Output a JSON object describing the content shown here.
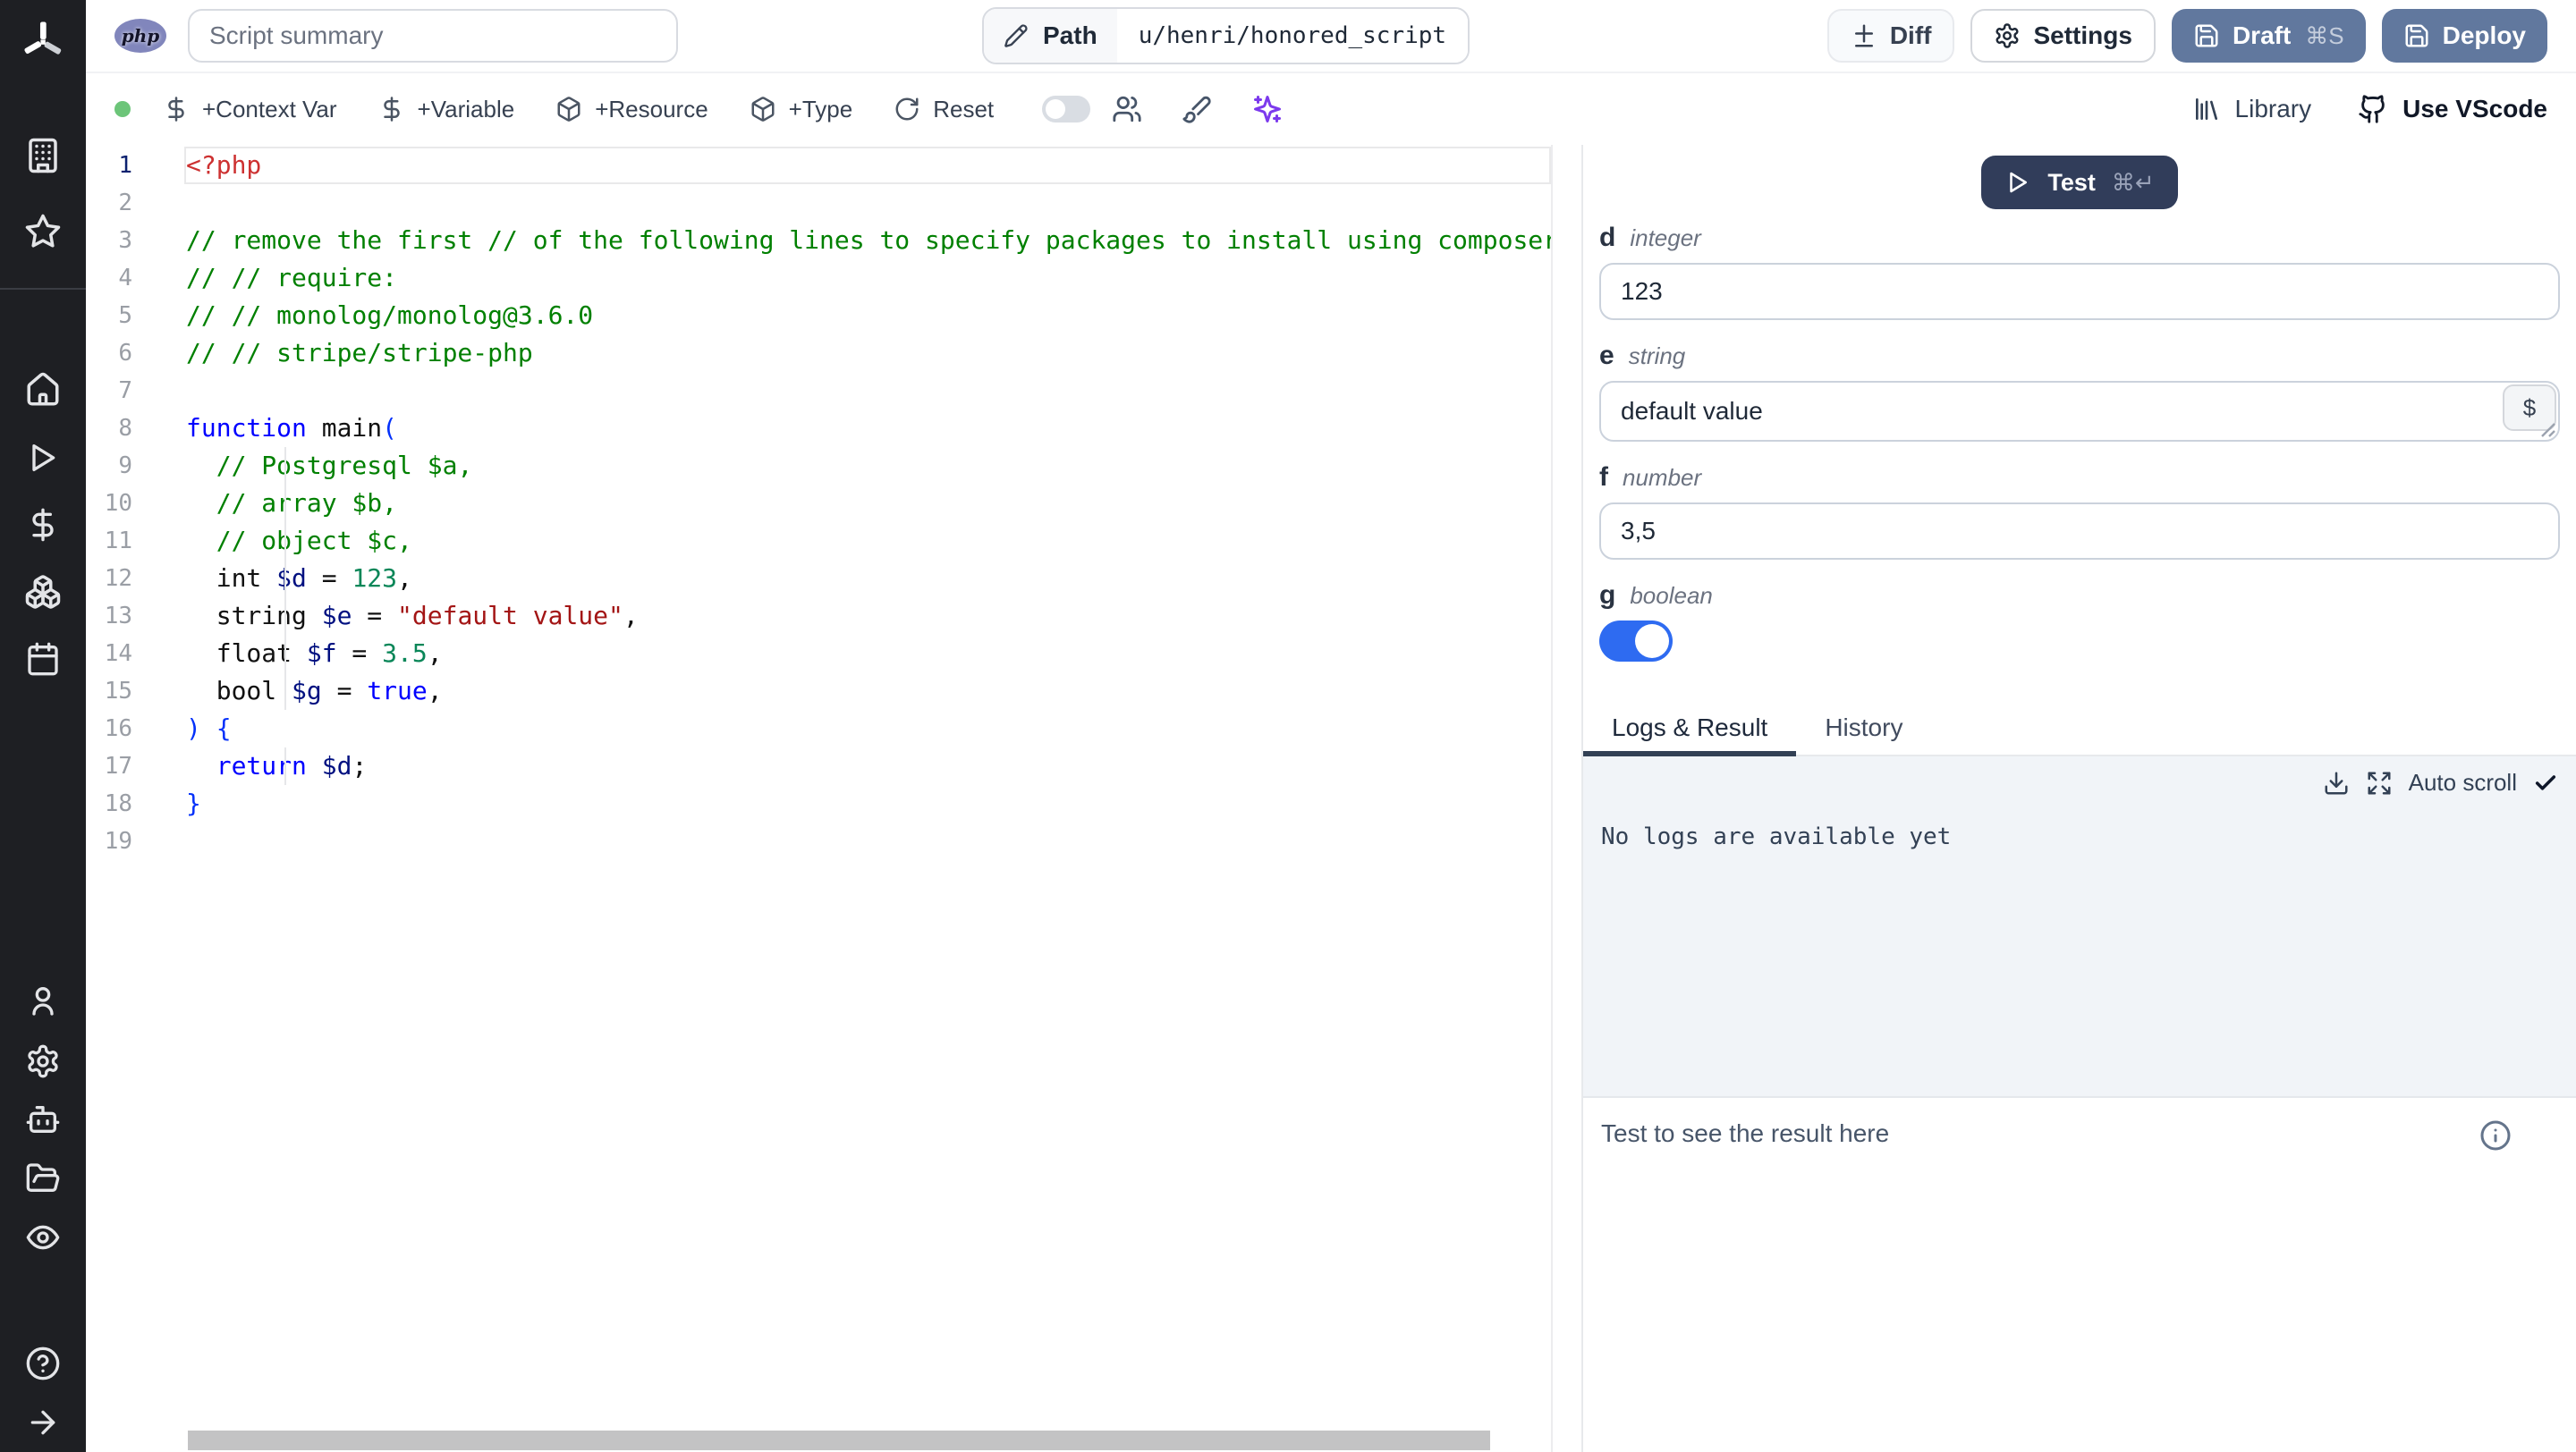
{
  "topbar": {
    "language_badge": "php",
    "summary_placeholder": "Script summary",
    "path_label": "Path",
    "path_value": "u/henri/honored_script",
    "diff_label": "Diff",
    "settings_label": "Settings",
    "draft_label": "Draft",
    "draft_shortcut": "⌘S",
    "deploy_label": "Deploy"
  },
  "toolbar": {
    "status": "ready",
    "context_var_label": "+Context Var",
    "variable_label": "+Variable",
    "resource_label": "+Resource",
    "type_label": "+Type",
    "reset_label": "Reset",
    "assistant_toggle_on": false,
    "library_label": "Library",
    "vscode_label": "Use VScode"
  },
  "sidebar": {
    "icons": [
      "windmill-logo",
      "building",
      "star",
      "home",
      "play",
      "dollar-sign",
      "boxes",
      "calendar",
      "user",
      "settings-gear",
      "bot",
      "folder-open",
      "eye",
      "help-circle",
      "arrow-right"
    ]
  },
  "editor": {
    "active_line": 1,
    "token_colors": {
      "tag": "#cd3131",
      "com": "#008000",
      "kw": "#0000ff",
      "var": "#001080",
      "num": "#098658",
      "str": "#a31515",
      "br": "#0431fa",
      "pl": "#111111"
    },
    "lines": [
      [
        [
          "tag",
          "<?php"
        ]
      ],
      [],
      [
        [
          "com",
          "// remove the first // of the following lines to specify packages to install using composer"
        ]
      ],
      [
        [
          "com",
          "// // require:"
        ]
      ],
      [
        [
          "com",
          "// // monolog/monolog@3.6.0"
        ]
      ],
      [
        [
          "com",
          "// // stripe/stripe-php"
        ]
      ],
      [],
      [
        [
          "kw",
          "function"
        ],
        [
          "pl",
          " main"
        ],
        [
          "br",
          "("
        ]
      ],
      [
        [
          "pl",
          "  "
        ],
        [
          "com",
          "// Postgresql $a,"
        ]
      ],
      [
        [
          "pl",
          "  "
        ],
        [
          "com",
          "// array $b,"
        ]
      ],
      [
        [
          "pl",
          "  "
        ],
        [
          "com",
          "// object $c,"
        ]
      ],
      [
        [
          "pl",
          "  int "
        ],
        [
          "var",
          "$d"
        ],
        [
          "pl",
          " = "
        ],
        [
          "num",
          "123"
        ],
        [
          "pl",
          ","
        ]
      ],
      [
        [
          "pl",
          "  string "
        ],
        [
          "var",
          "$e"
        ],
        [
          "pl",
          " = "
        ],
        [
          "str",
          "\"default value\""
        ],
        [
          "pl",
          ","
        ]
      ],
      [
        [
          "pl",
          "  float "
        ],
        [
          "var",
          "$f"
        ],
        [
          "pl",
          " = "
        ],
        [
          "num",
          "3.5"
        ],
        [
          "pl",
          ","
        ]
      ],
      [
        [
          "pl",
          "  bool "
        ],
        [
          "var",
          "$g"
        ],
        [
          "pl",
          " = "
        ],
        [
          "kw",
          "true"
        ],
        [
          "pl",
          ","
        ]
      ],
      [
        [
          "br",
          ") {"
        ]
      ],
      [
        [
          "pl",
          "  "
        ],
        [
          "kw",
          "return"
        ],
        [
          "pl",
          " "
        ],
        [
          "var",
          "$d"
        ],
        [
          "pl",
          ";"
        ]
      ],
      [
        [
          "br",
          "}"
        ]
      ],
      []
    ]
  },
  "right_panel": {
    "test_label": "Test",
    "test_shortcut": "⌘↵",
    "fields": [
      {
        "name": "d",
        "type": "integer",
        "value": "123"
      },
      {
        "name": "e",
        "type": "string",
        "value": "default value",
        "var_picker": "$"
      },
      {
        "name": "f",
        "type": "number",
        "value": "3,5"
      },
      {
        "name": "g",
        "type": "boolean",
        "value": true
      }
    ],
    "tabs": [
      "Logs & Result",
      "History"
    ],
    "active_tab": "Logs & Result",
    "autoscroll_label": "Auto scroll",
    "logs_empty_text": "No logs are available yet",
    "result_placeholder": "Test to see the result here"
  },
  "colors": {
    "sidebar_bg": "#1e1f23",
    "primary_button": "#61789e",
    "test_button": "#313d5a",
    "toggle_on": "#2e6bf1",
    "logs_bg": "#f1f4f8",
    "status_dot": "#6cc579",
    "ai_icon": "#7c3aed",
    "php_badge": "#8186bc"
  }
}
